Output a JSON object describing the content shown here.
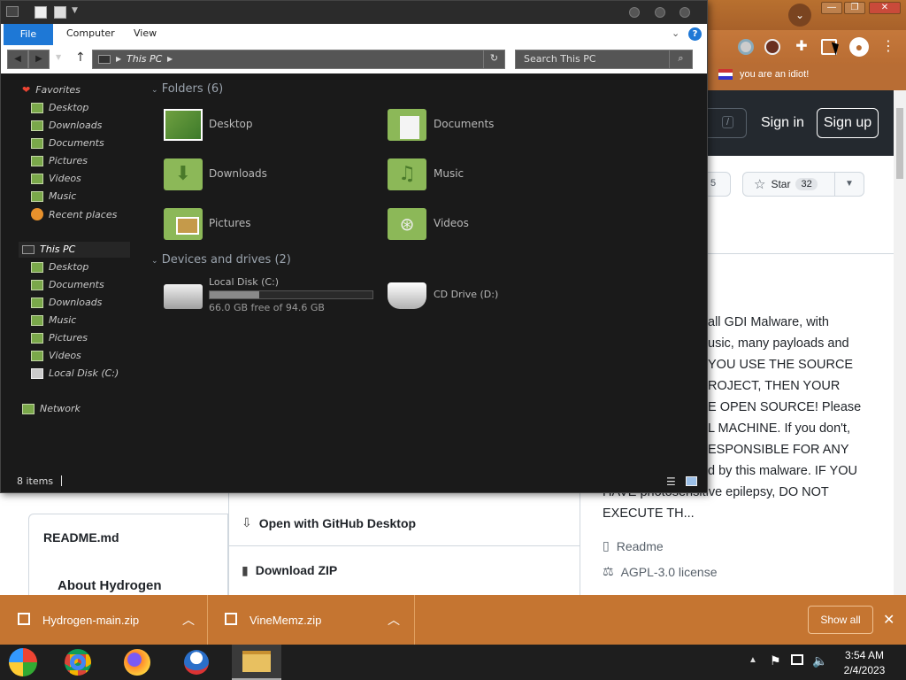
{
  "browser": {
    "bookmark_text": "you are an idiot!",
    "sign_in": "Sign in",
    "sign_up": "Sign up",
    "slash_key": "/",
    "fork_count": "5",
    "star_label": "Star",
    "star_count": "32",
    "description_lines": [
      "all GDI Malware, with",
      "usic, many payloads and",
      "YOU USE THE SOURCE",
      "ROJECT, THEN YOUR",
      "E OPEN SOURCE! Please",
      "L MACHINE. If you don't,",
      "ESPONSIBLE FOR ANY",
      "d by this malware. IF YOU",
      "HAVE photosensitive epilepsy, DO NOT",
      "EXECUTE TH..."
    ],
    "readme_link": "Readme",
    "license_link": "AGPL-3.0 license",
    "readme_tab": "README.md",
    "about_heading": "About Hydrogen",
    "open_desktop": "Open with GitHub Desktop",
    "download_zip": "Download ZIP"
  },
  "explorer": {
    "ribbon_tabs": [
      "File",
      "Computer",
      "View"
    ],
    "address": "This PC",
    "search_placeholder": "Search This PC",
    "nav": {
      "favorites": "Favorites",
      "fav_items": [
        "Desktop",
        "Downloads",
        "Documents",
        "Pictures",
        "Videos",
        "Music",
        "Recent places"
      ],
      "this_pc": "This PC",
      "pc_items": [
        "Desktop",
        "Documents",
        "Downloads",
        "Music",
        "Pictures",
        "Videos",
        "Local Disk (C:)"
      ],
      "network": "Network"
    },
    "folders_header": "Folders (6)",
    "folders": [
      "Desktop",
      "Documents",
      "Downloads",
      "Music",
      "Pictures",
      "Videos"
    ],
    "devices_header": "Devices and drives (2)",
    "drives": [
      {
        "name": "Local Disk (C:)",
        "free": "66.0 GB free of 94.6 GB",
        "used_fraction": 0.302
      },
      {
        "name": "CD Drive (D:)"
      }
    ],
    "status": "8 items"
  },
  "downloads": {
    "items": [
      "Hydrogen-main.zip",
      "VineMemz.zip"
    ],
    "show_all": "Show all"
  },
  "taskbar": {
    "time": "3:54 AM",
    "date": "2/4/2023"
  }
}
